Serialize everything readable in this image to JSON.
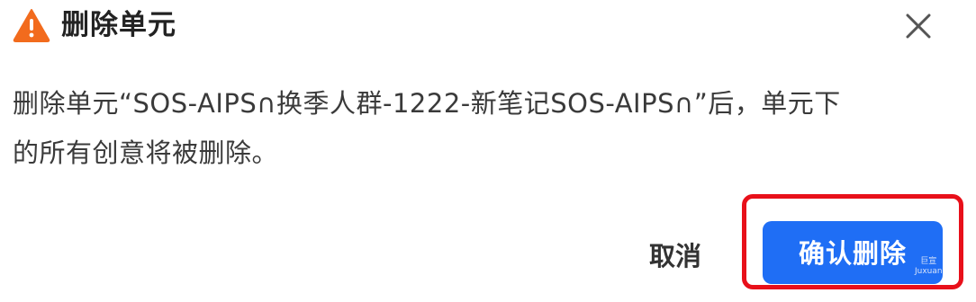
{
  "dialog": {
    "title": "删除单元",
    "icon": "warning-icon",
    "close_icon": "close-icon",
    "message_line1": "删除单元“SOS-AIPS∩换季人群-1222-新笔记SOS-AIPS∩”后，单元下",
    "message_line2": "的所有创意将被删除。",
    "cancel_label": "取消",
    "confirm_label": "确认删除"
  },
  "watermark": {
    "line1": "巨宣",
    "line2": "Juxuan"
  },
  "colors": {
    "warning": "#f26b1d",
    "primary": "#1f6ef5",
    "highlight": "#e8101a"
  }
}
